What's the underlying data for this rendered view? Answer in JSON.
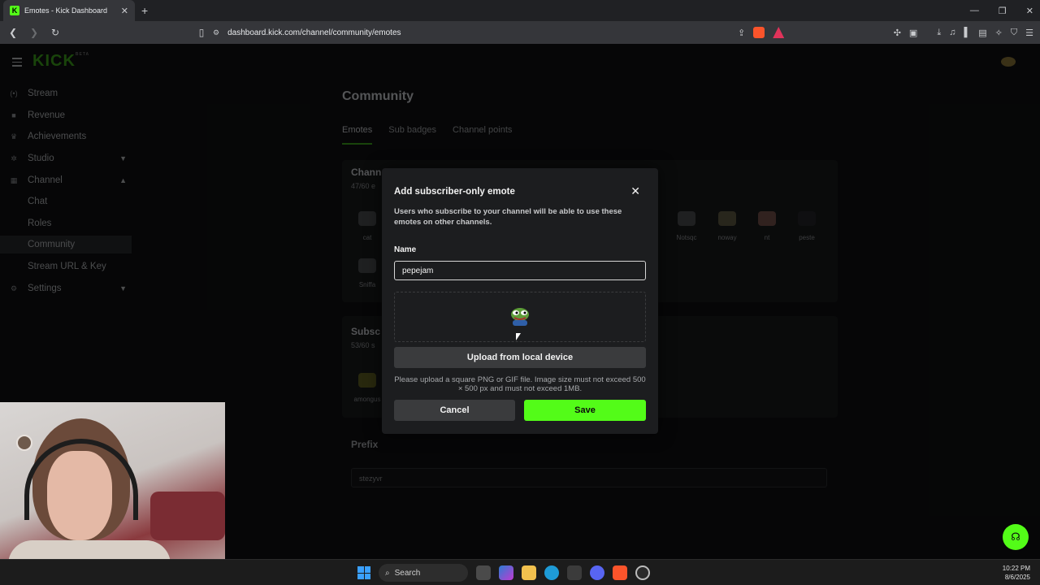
{
  "browser": {
    "tab_title": "Emotes - Kick Dashboard",
    "favicon_letter": "K",
    "url": "dashboard.kick.com/channel/community/emotes"
  },
  "brand": {
    "logo": "KICK",
    "logo_sup": "BETA",
    "accent": "#53fc18"
  },
  "sidebar": {
    "items": [
      {
        "label": "Stream",
        "icon": "broadcast-icon"
      },
      {
        "label": "Revenue",
        "icon": "revenue-icon"
      },
      {
        "label": "Achievements",
        "icon": "trophy-icon"
      },
      {
        "label": "Studio",
        "icon": "studio-icon"
      },
      {
        "label": "Channel",
        "icon": "channel-icon"
      },
      {
        "label": "Chat"
      },
      {
        "label": "Roles"
      },
      {
        "label": "Community"
      },
      {
        "label": "Stream URL & Key"
      },
      {
        "label": "Settings",
        "icon": "gear-icon"
      }
    ]
  },
  "main": {
    "title": "Community",
    "tabs": [
      "Emotes",
      "Sub badges",
      "Channel points"
    ],
    "channel_card": {
      "title": "Chann",
      "count": "47/60 e",
      "emotes": [
        "cat",
        "Sniffa",
        "Notsqc",
        "noway",
        "nt",
        "peste"
      ]
    },
    "sub_card": {
      "title": "Subsc",
      "count": "53/60 s",
      "emotes": [
        "amongus"
      ]
    },
    "prefix": {
      "label": "Prefix",
      "value": "stezyvr"
    }
  },
  "modal": {
    "title": "Add subscriber-only emote",
    "description": "Users who subscribe to your channel will be able to use these emotes on other channels.",
    "name_label": "Name",
    "name_value": "pepejam",
    "upload_label": "Upload from local device",
    "hint": "Please upload a square PNG or GIF file. Image size must not exceed 500 × 500 px and must not exceed 1MB.",
    "cancel_label": "Cancel",
    "save_label": "Save"
  },
  "taskbar": {
    "search_label": "Search",
    "time": "10:22 PM",
    "date": "8/6/2025"
  }
}
